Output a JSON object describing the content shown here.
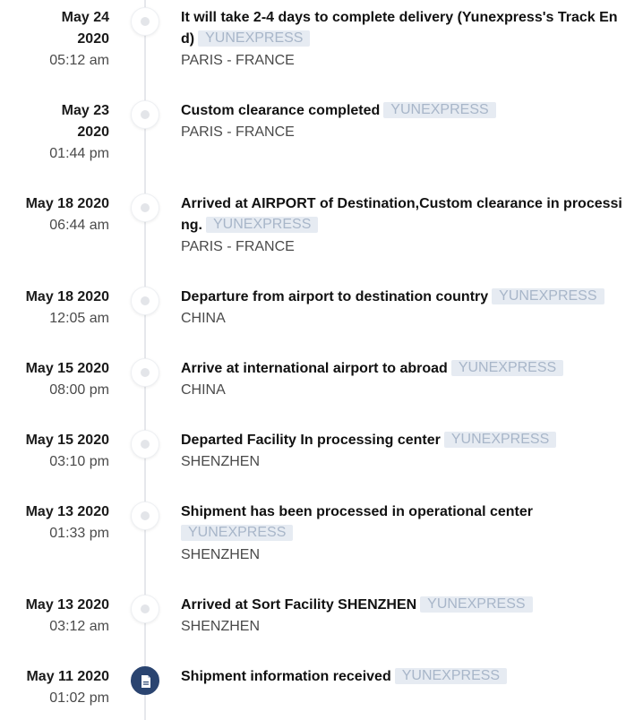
{
  "events": [
    {
      "date": "May 24 2020",
      "date_line1": "May 24",
      "date_line2": "2020",
      "time": "05:12 am",
      "title": "It will take 2-4 days to complete delivery (Yunexpress's Track End)",
      "carrier": "YUNEXPRESS",
      "location": "PARIS - FRANCE"
    },
    {
      "date": "May 23 2020",
      "date_line1": "May 23",
      "date_line2": "2020",
      "time": "01:44 pm",
      "title": "Custom clearance completed",
      "carrier": "YUNEXPRESS",
      "location": "PARIS - FRANCE"
    },
    {
      "date": "May 18 2020",
      "time": "06:44 am",
      "title": "Arrived at AIRPORT of Destination,Custom clearance in processing.",
      "carrier": "YUNEXPRESS",
      "location": "PARIS - FRANCE"
    },
    {
      "date": "May 18 2020",
      "time": "12:05 am",
      "title": "Departure from airport to destination country",
      "carrier": "YUNEXPRESS",
      "location": "CHINA"
    },
    {
      "date": "May 15 2020",
      "time": "08:00 pm",
      "title": "Arrive at international airport to abroad",
      "carrier": "YUNEXPRESS",
      "location": "CHINA"
    },
    {
      "date": "May 15 2020",
      "time": "03:10 pm",
      "title": "Departed Facility In processing center",
      "carrier": "YUNEXPRESS",
      "location": "SHENZHEN"
    },
    {
      "date": "May 13 2020",
      "time": "01:33 pm",
      "title": "Shipment has been processed in operational center",
      "carrier": "YUNEXPRESS",
      "location": "SHENZHEN"
    },
    {
      "date": "May 13 2020",
      "time": "03:12 am",
      "title": "Arrived at Sort Facility SHENZHEN",
      "carrier": "YUNEXPRESS",
      "location": "SHENZHEN"
    },
    {
      "date": "May 11 2020",
      "time": "01:02 pm",
      "title": "Shipment information received",
      "carrier": "YUNEXPRESS",
      "location": ""
    }
  ],
  "icons": {
    "dot": "timeline-dot-icon",
    "active": "document-icon"
  },
  "colors": {
    "active_dot": "#2a4470",
    "tag_bg": "#e6ebf2",
    "tag_text": "#a8b6c9"
  }
}
